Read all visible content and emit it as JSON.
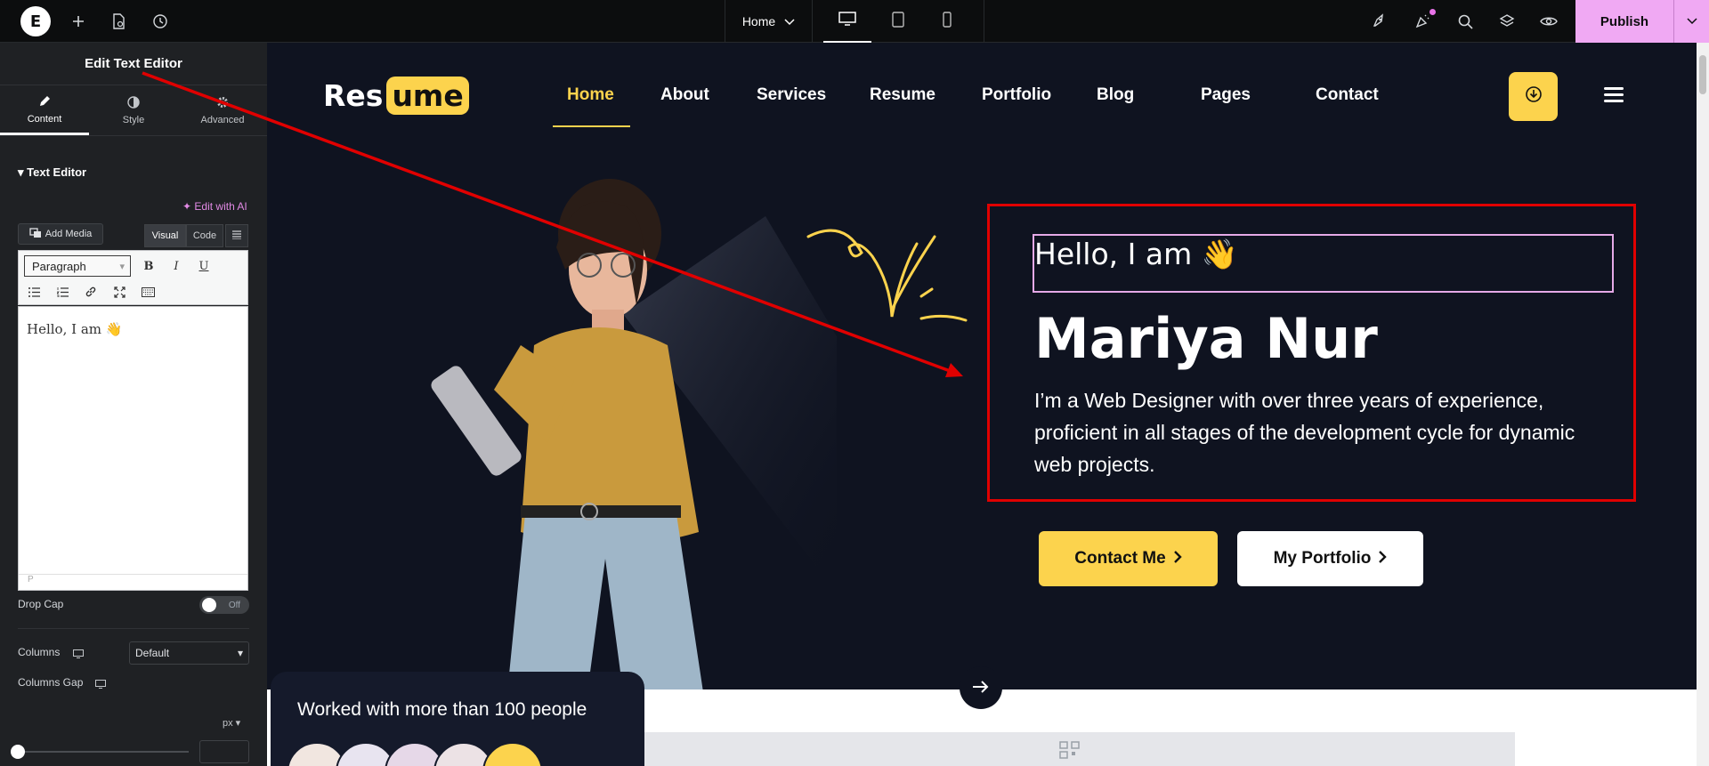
{
  "topbar": {
    "page_selector": "Home",
    "publish_label": "Publish"
  },
  "panel": {
    "title": "Edit Text Editor",
    "tabs": [
      {
        "label": "Content"
      },
      {
        "label": "Style"
      },
      {
        "label": "Advanced"
      }
    ],
    "section_title": "Text Editor",
    "edit_with_ai": "Edit with AI",
    "add_media": "Add Media",
    "view_tabs": [
      "Visual",
      "Code"
    ],
    "format_select": "Paragraph",
    "editor_content": "Hello, I am 👋",
    "editor_path": "P",
    "drop_cap_label": "Drop Cap",
    "drop_cap_state": "Off",
    "columns_label": "Columns",
    "columns_value": "Default",
    "columns_gap_label": "Columns Gap",
    "columns_gap_unit": "px"
  },
  "site": {
    "logo_part1": "Res",
    "logo_part2": "ume",
    "nav": [
      "Home",
      "About",
      "Services",
      "Resume",
      "Portfolio",
      "Blog",
      "Pages",
      "Contact"
    ],
    "greeting": "Hello, I am 👋",
    "name": "Mariya Nur",
    "bio": "I’m a Web Designer with over three years of experience, proficient in all stages of the development cycle for dynamic web projects.",
    "contact_button": "Contact Me",
    "portfolio_button": "My Portfolio",
    "worked_with": "Worked with more than 100 people"
  },
  "colors": {
    "accent_yellow": "#fcd34d",
    "publish_pink": "#f0a9f3",
    "annotation_red": "#e00000",
    "canvas_bg": "#0f1320"
  }
}
